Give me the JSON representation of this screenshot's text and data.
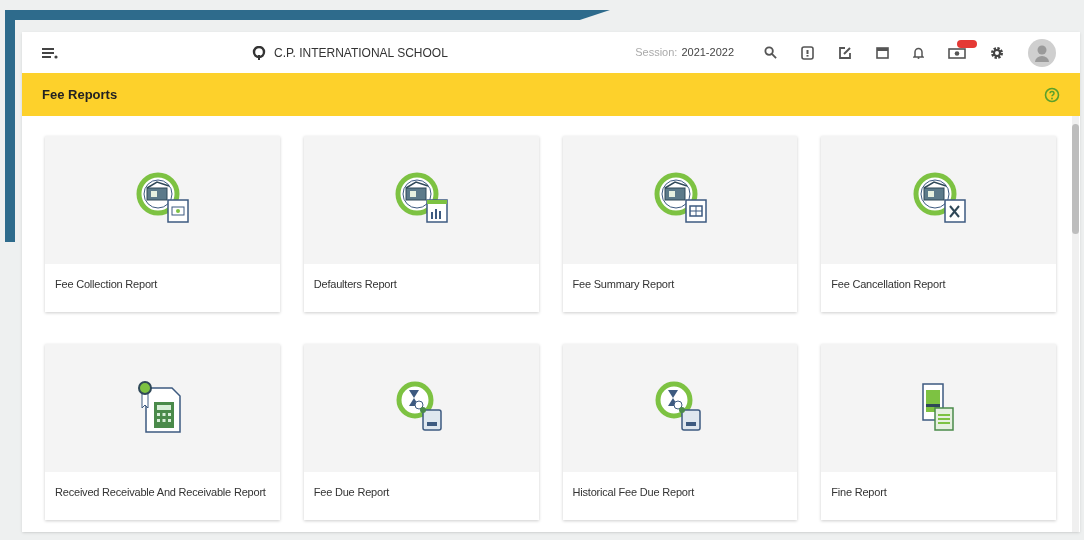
{
  "header": {
    "school_name": "C.P. INTERNATIONAL SCHOOL",
    "session_label": "Session:",
    "session_value": "2021-2022",
    "new_badge": true
  },
  "page_title": "Fee Reports",
  "reports": [
    {
      "title": "Fee Collection Report",
      "kind": "collection"
    },
    {
      "title": "Defaulters Report",
      "kind": "defaulters"
    },
    {
      "title": "Fee Summary Report",
      "kind": "summary"
    },
    {
      "title": "Fee Cancellation Report",
      "kind": "cancellation"
    },
    {
      "title": "Received Receivable And Receivable Report",
      "kind": "receivable"
    },
    {
      "title": "Fee Due Report",
      "kind": "due"
    },
    {
      "title": "Historical Fee Due Report",
      "kind": "due"
    },
    {
      "title": "Fine Report",
      "kind": "fine"
    }
  ]
}
